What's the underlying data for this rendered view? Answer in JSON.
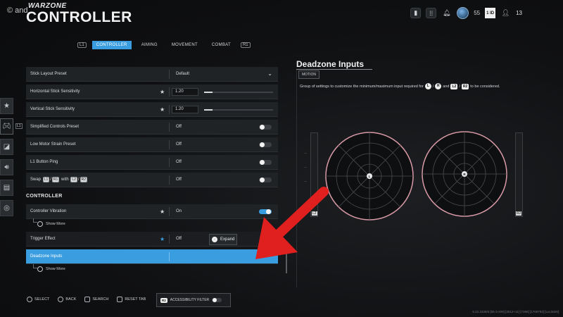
{
  "watermark": "© and",
  "header": {
    "brand_small": "WARZONE",
    "title": "CONTROLLER",
    "points": "55",
    "badge": "1 ID",
    "count": "13"
  },
  "tabs": {
    "left_key": "L1",
    "right_key": "R1",
    "items": [
      {
        "label": "CONTROLLER",
        "active": true
      },
      {
        "label": "AIMING"
      },
      {
        "label": "MOVEMENT"
      },
      {
        "label": "COMBAT"
      }
    ]
  },
  "side_tag": "L1",
  "settings": {
    "rows": [
      {
        "label": "Stick Layout Preset",
        "value": "Default"
      },
      {
        "label": "Horizontal Stick Sensitivity",
        "value": "1.20"
      },
      {
        "label": "Vertical Stick Sensitivity",
        "value": "1.20"
      },
      {
        "label": "Simplified Controls Preset",
        "value": "Off"
      },
      {
        "label": "Low Motor Strain Preset",
        "value": "Off"
      },
      {
        "label": "L1 Button Ping",
        "value": "Off"
      },
      {
        "label_prefix": "Swap",
        "label_with": "with",
        "value": "Off"
      }
    ],
    "section": "CONTROLLER",
    "rows2": [
      {
        "label": "Controller Vibration",
        "value": "On"
      },
      {
        "label": "Trigger Effect",
        "value": "Off"
      },
      {
        "label": "Deadzone Inputs"
      }
    ],
    "show_more": "Show More",
    "expand": "Expand"
  },
  "deadzone": {
    "title": "Deadzone Inputs",
    "tag": "MOTION",
    "desc_a": "Group of settings to customize the minimum/maximum input required for",
    "desc_and": "and",
    "desc_b": "to be considered.",
    "keys": {
      "L": "L",
      "R": "R",
      "L2": "L2",
      "R2": "R2",
      "slash": "/"
    },
    "left_label": "L2",
    "right_label": "R2"
  },
  "bottom": {
    "select": "SELECT",
    "back": "BACK",
    "search": "SEARCH",
    "reset": "RESET TAB",
    "accessibility": "ACCESSIBILITY FILTER"
  },
  "build_string": "5.22.2336/6 [55-3-209] [3012+11] [7368] [1769792] [Luc3a/et]"
}
